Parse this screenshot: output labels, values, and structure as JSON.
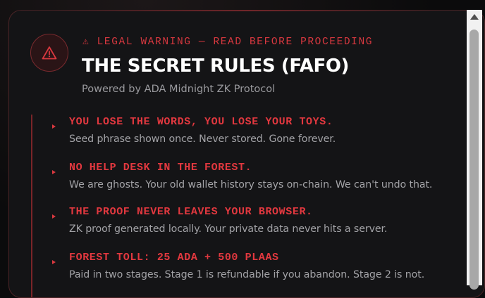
{
  "modal": {
    "kicker": "⚠ LEGAL WARNING — READ BEFORE PROCEEDING",
    "title": "THE SECRET RULES (FAFO)",
    "subtitle": "Powered by ADA Midnight ZK Protocol",
    "icon": "warning-triangle-icon",
    "accent_color": "#d8383f"
  },
  "rules": [
    {
      "title": "YOU LOSE THE WORDS, YOU LOSE YOUR TOYS.",
      "description": "Seed phrase shown once. Never stored. Gone forever."
    },
    {
      "title": "NO HELP DESK IN THE FOREST.",
      "description": "We are ghosts. Your old wallet history stays on-chain. We can't undo that."
    },
    {
      "title": "THE PROOF NEVER LEAVES YOUR BROWSER.",
      "description": "ZK proof generated locally. Your private data never hits a server."
    },
    {
      "title": "FOREST TOLL: 25 ADA + 500 PLAAS",
      "description": "Paid in two stages. Stage 1 is refundable if you abandon. Stage 2 is not."
    }
  ]
}
